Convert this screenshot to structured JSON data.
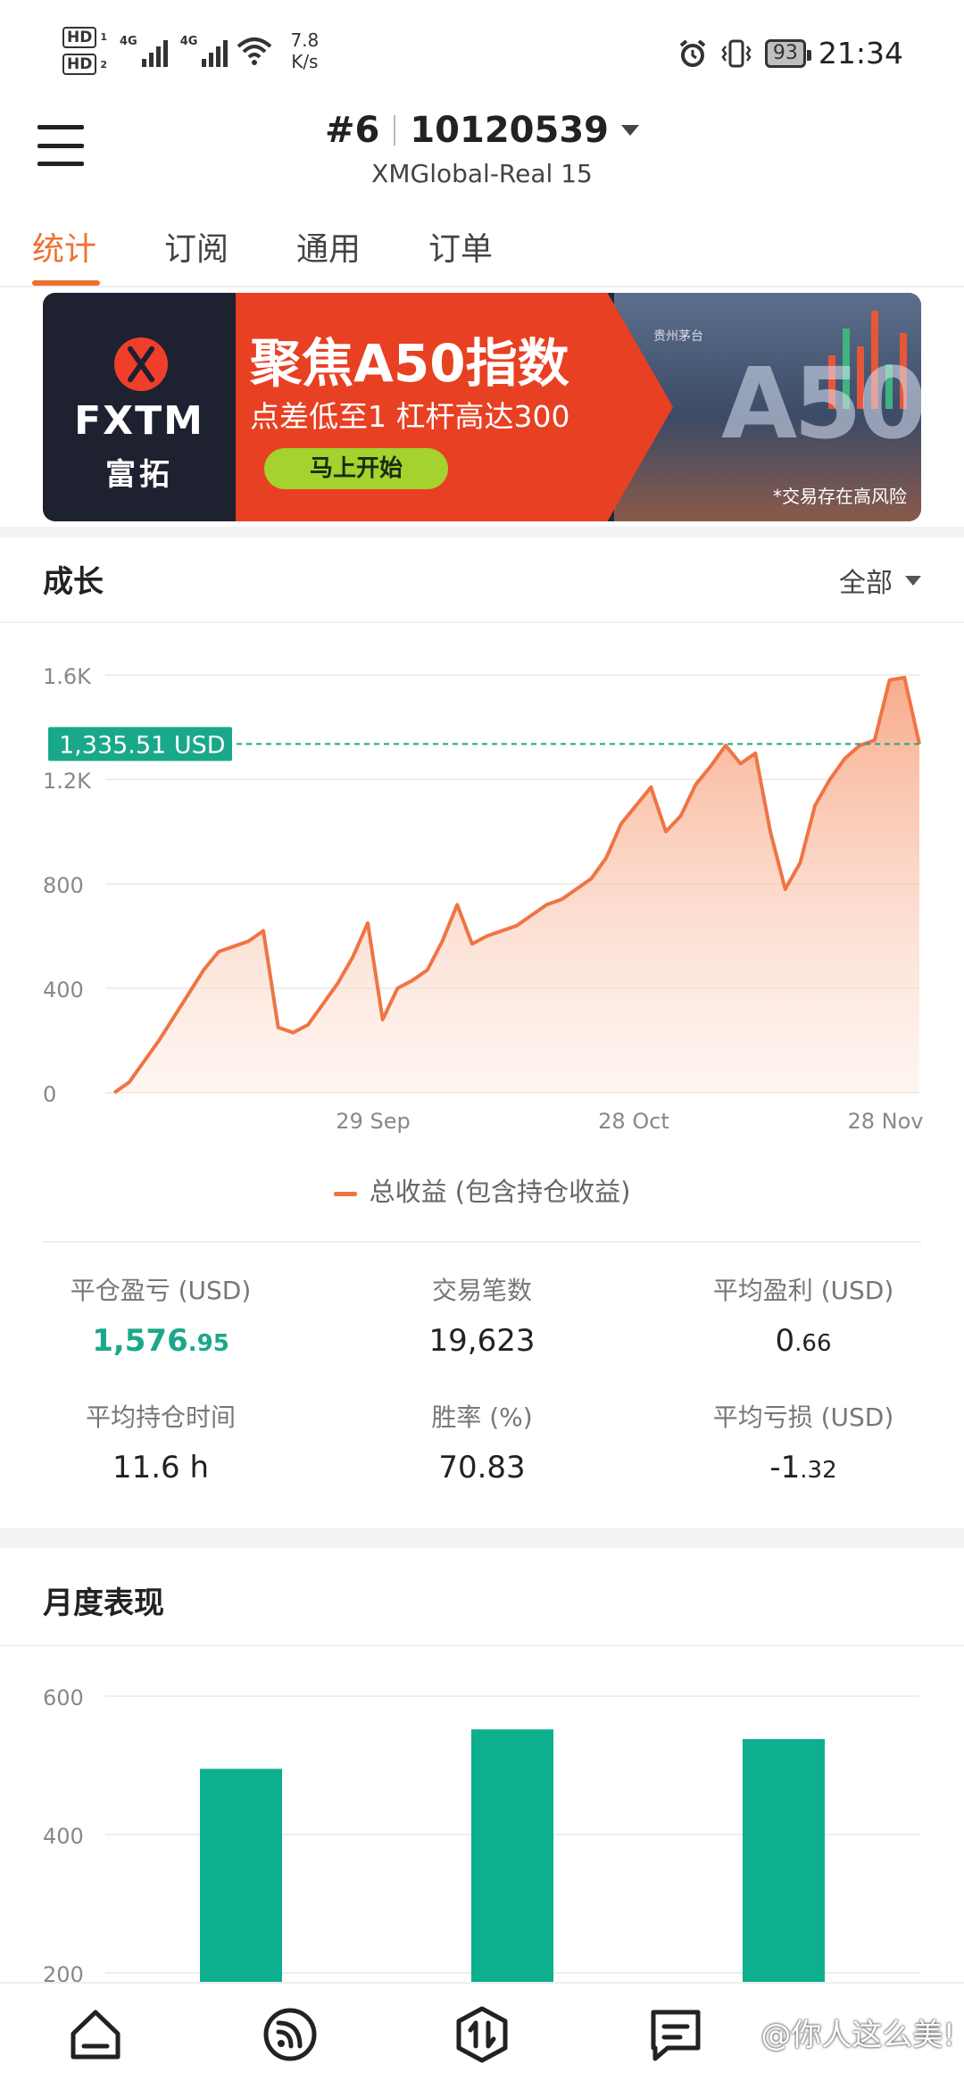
{
  "status_bar": {
    "hd1": "HD",
    "hd2": "HD",
    "sim1_index": "1",
    "sim2_index": "2",
    "net1": "4G",
    "net2": "4G",
    "speed_value": "7.8",
    "speed_unit": "K/s",
    "battery": "93",
    "time": "21:34",
    "icons": [
      "signal-icon",
      "wifi-icon",
      "alarm-icon",
      "vibrate-icon",
      "battery-icon"
    ]
  },
  "header": {
    "account_index": "#6",
    "account_number": "10120539",
    "server": "XMGlobal-Real 15",
    "menu_icon": "hamburger-menu-icon"
  },
  "tabs": [
    {
      "label": "统计",
      "active": true
    },
    {
      "label": "订阅",
      "active": false
    },
    {
      "label": "通用",
      "active": false
    },
    {
      "label": "订单",
      "active": false
    }
  ],
  "banner": {
    "brand": "FXTM",
    "brand_cn": "富拓",
    "title": "聚焦A50指数",
    "subtitle": "点差低至1 杠杆高达300",
    "cta": "马上开始",
    "risk_note": "*交易存在高风险",
    "city_tag": "贵州茅台",
    "a50_text": "A50"
  },
  "growth": {
    "title": "成长",
    "filter": "全部",
    "current_label": "1,335.51 USD",
    "legend": "总收益 (包含持仓收益)"
  },
  "chart_data": {
    "type": "area",
    "series": [
      {
        "name": "总收益 (包含持仓收益)",
        "values": [
          0,
          40,
          120,
          200,
          290,
          380,
          470,
          540,
          560,
          580,
          620,
          250,
          230,
          260,
          340,
          420,
          520,
          650,
          280,
          400,
          430,
          470,
          580,
          720,
          570,
          600,
          620,
          640,
          680,
          720,
          740,
          780,
          820,
          900,
          1030,
          1100,
          1170,
          1000,
          1060,
          1180,
          1250,
          1330,
          1260,
          1300,
          1000,
          780,
          880,
          1100,
          1200,
          1280,
          1330,
          1350,
          1580,
          1590,
          1335.51
        ]
      }
    ],
    "x_ticks": [
      "29 Sep",
      "28 Oct",
      "28 Nov"
    ],
    "y_ticks": [
      "0",
      "400",
      "800",
      "1.2K",
      "1.6K"
    ],
    "ylim": [
      0,
      1600
    ],
    "reference_line": 1335.51,
    "colors": {
      "line": "#ef7444",
      "fill": "#f9b89a",
      "reference": "#1aa88a",
      "grid": "#eeeeee"
    },
    "grid": true
  },
  "stats": [
    {
      "label": "平仓盈亏 (USD)",
      "int": "1,576",
      "frac": ".95",
      "green": true
    },
    {
      "label": "交易笔数",
      "int": "19,623",
      "frac": "",
      "green": false
    },
    {
      "label": "平均盈利 (USD)",
      "int": "0",
      "frac": ".66",
      "green": false
    },
    {
      "label": "平均持仓时间",
      "int": "11.6 h",
      "frac": "",
      "green": false
    },
    {
      "label": "胜率 (%)",
      "int": "70.83",
      "frac": "",
      "green": false
    },
    {
      "label": "平均亏损 (USD)",
      "int": "-1",
      "frac": ".32",
      "green": false
    }
  ],
  "monthly": {
    "title": "月度表现",
    "chart_data": {
      "type": "bar",
      "values": [
        495,
        552,
        538
      ],
      "y_ticks": [
        "200",
        "400",
        "600"
      ],
      "ylim": [
        200,
        600
      ],
      "color": "#0daf8e",
      "grid": true
    }
  },
  "bottom_nav": {
    "icons": [
      "home-icon",
      "signal-feed-icon",
      "trade-icon",
      "message-icon"
    ],
    "watermark": "@你人这么美!"
  }
}
